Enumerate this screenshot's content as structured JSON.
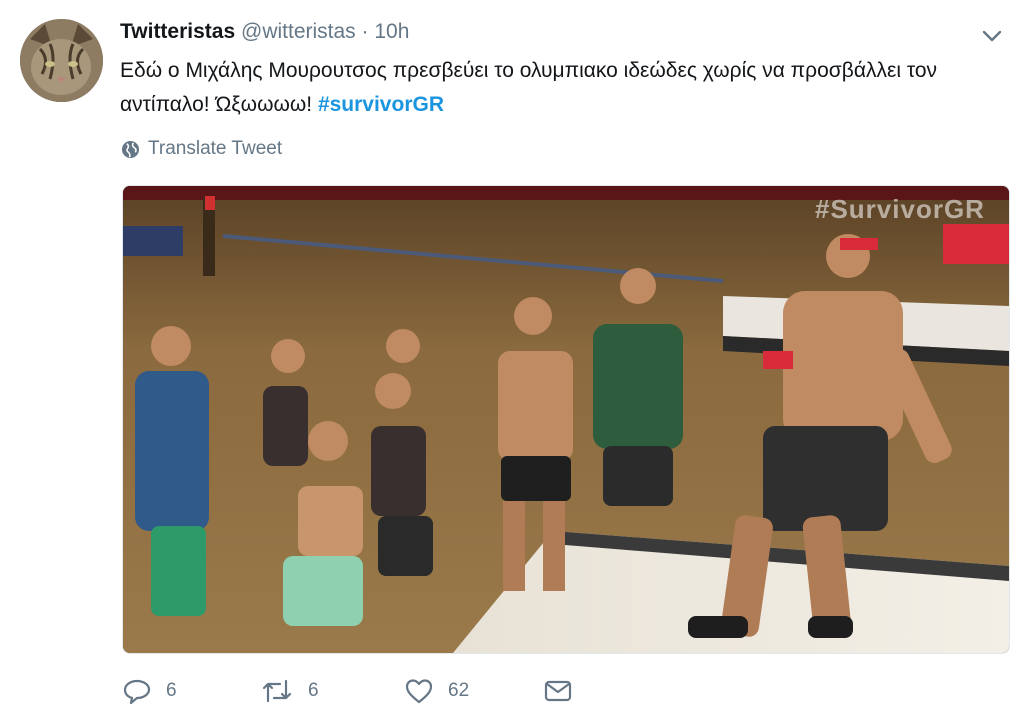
{
  "tweet": {
    "author_name": "Twitteristas",
    "author_handle": "@witteristas",
    "separator": "·",
    "time": "10h",
    "text": "Εδώ ο Μιχάλης Μουρουτσος πρεσβεύει το ολυμπιακο ιδεώδες χωρίς να προσβάλλει τον αντίπαλο! Ώξωωωω!",
    "hashtag": "#survivorGR",
    "translate_label": "Translate Tweet",
    "media_watermark": "#SurvivorGR"
  },
  "actions": {
    "reply_count": "6",
    "retweet_count": "6",
    "like_count": "62"
  },
  "icons": {
    "avatar": "cat-avatar",
    "chevron": "chevron-down-icon",
    "globe": "globe-icon",
    "reply": "reply-icon",
    "retweet": "retweet-icon",
    "like": "heart-icon",
    "message": "envelope-icon"
  },
  "colors": {
    "text": "#14171a",
    "secondary": "#657786",
    "hashtag": "#1b95e0"
  }
}
